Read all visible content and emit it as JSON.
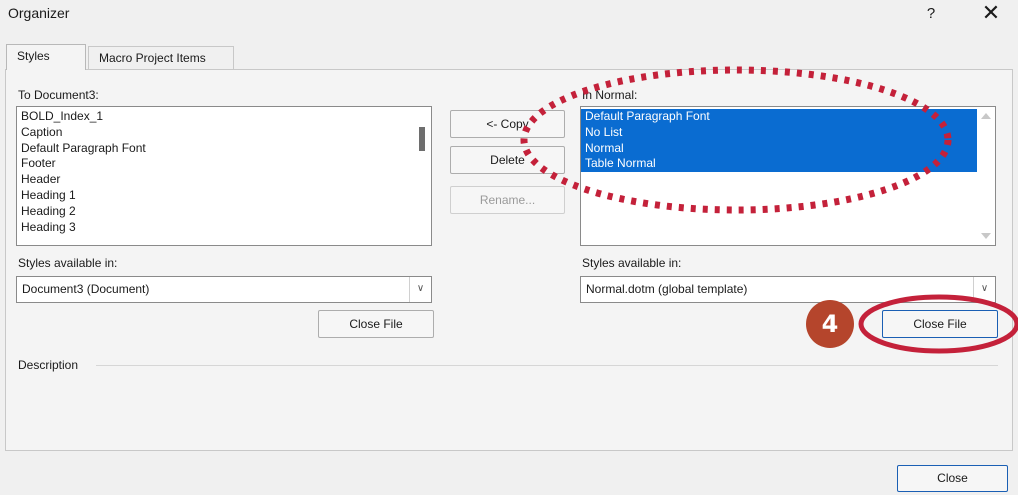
{
  "window": {
    "title": "Organizer",
    "help_label": "?",
    "close_glyph": "✕"
  },
  "tabs": [
    {
      "label": "Styles",
      "active": true
    },
    {
      "label": "Macro Project Items",
      "active": false
    }
  ],
  "left_pane": {
    "header": "To Document3:",
    "items": [
      "BOLD_Index_1",
      "Caption",
      "Default Paragraph Font",
      "Footer",
      "Header",
      "Heading 1",
      "Heading 2",
      "Heading 3"
    ],
    "available_label": "Styles available in:",
    "available_value": "Document3 (Document)",
    "close_file_label": "Close File"
  },
  "middle_buttons": {
    "copy_label": "<- Copy",
    "delete_label": "Delete",
    "rename_label": "Rename..."
  },
  "right_pane": {
    "header": "In Normal:",
    "items": [
      "Default Paragraph Font",
      "No List",
      "Normal",
      "Table Normal"
    ],
    "selected_items": [
      "Default Paragraph Font",
      "No List",
      "Normal",
      "Table Normal"
    ],
    "available_label": "Styles available in:",
    "available_value": "Normal.dotm (global template)",
    "close_file_label": "Close File"
  },
  "description_label": "Description",
  "footer": {
    "close_label": "Close"
  },
  "annotations": {
    "step_badge": "4",
    "badge_color": "#b5452c",
    "highlight_color": "#c4213a",
    "selection_color": "#0a6cd1"
  }
}
